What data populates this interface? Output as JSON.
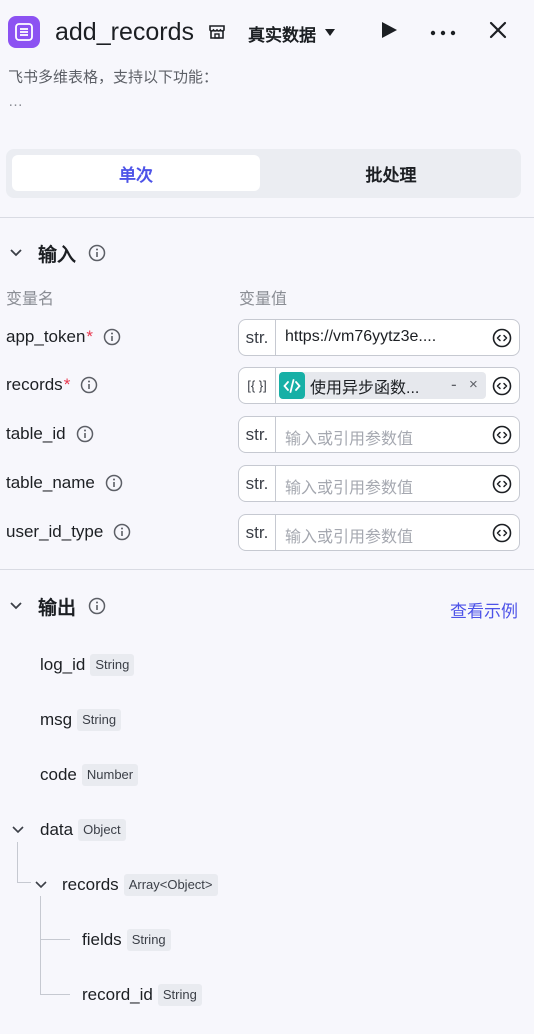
{
  "header": {
    "title": "add_records",
    "env_label": "真实数据",
    "app_icon": "list-icon",
    "accent": "#8c52f2"
  },
  "description": {
    "text": "飞书多维表格，支持以下功能：",
    "more": "…"
  },
  "tabs": [
    {
      "label": "单次",
      "active": true
    },
    {
      "label": "批处理",
      "active": false
    }
  ],
  "input_section": {
    "title": "输入",
    "col_name": "变量名",
    "col_value": "变量值",
    "params": [
      {
        "name": "app_token",
        "required": "*",
        "type": "str.",
        "value": "https://vm76yytz3e....",
        "placeholder": ""
      },
      {
        "name": "records",
        "required": "*",
        "type": "[{ }]",
        "chip_label": "使用异步函数...",
        "chip_dash": "-",
        "chip_close": "×"
      },
      {
        "name": "table_id",
        "required": "",
        "type": "str.",
        "value": "",
        "placeholder": "输入或引用参数值"
      },
      {
        "name": "table_name",
        "required": "",
        "type": "str.",
        "value": "",
        "placeholder": "输入或引用参数值"
      },
      {
        "name": "user_id_type",
        "required": "",
        "type": "str.",
        "value": "",
        "placeholder": "输入或引用参数值"
      }
    ]
  },
  "output_section": {
    "title": "输出",
    "example_link": "查看示例",
    "fields": [
      {
        "name": "log_id",
        "type": "String"
      },
      {
        "name": "msg",
        "type": "String"
      },
      {
        "name": "code",
        "type": "Number"
      },
      {
        "name": "data",
        "type": "Object"
      },
      {
        "name": "records",
        "type": "Array<Object>"
      },
      {
        "name": "fields",
        "type": "String"
      },
      {
        "name": "record_id",
        "type": "String"
      }
    ]
  }
}
